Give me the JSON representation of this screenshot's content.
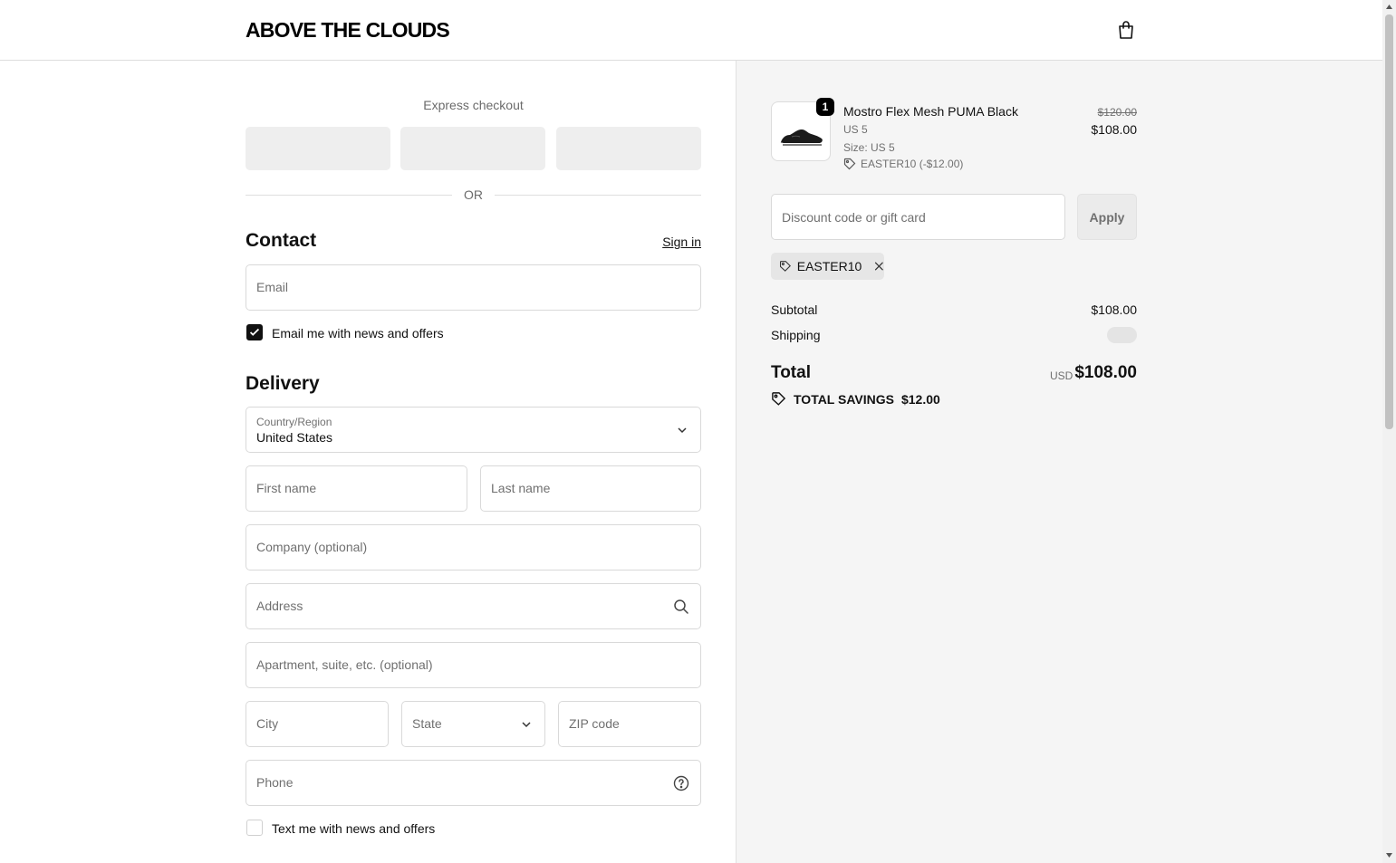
{
  "header": {
    "logo": "ABOVE THE CLOUDS",
    "cart_icon": "shopping-bag-icon"
  },
  "express": {
    "label": "Express checkout",
    "or": "OR"
  },
  "contact": {
    "title": "Contact",
    "signin": "Sign in",
    "email_placeholder": "Email",
    "news_checkbox_label": "Email me with news and offers",
    "news_checked": true
  },
  "delivery": {
    "title": "Delivery",
    "country_label": "Country/Region",
    "country_value": "United States",
    "first_name": "First name",
    "last_name": "Last name",
    "company": "Company (optional)",
    "address": "Address",
    "apartment": "Apartment, suite, etc. (optional)",
    "city": "City",
    "state": "State",
    "zip": "ZIP code",
    "phone": "Phone",
    "text_checkbox_label": "Text me with news and offers",
    "text_checked": false
  },
  "order": {
    "item": {
      "qty": "1",
      "name": "Mostro Flex Mesh PUMA Black",
      "variant": "US 5",
      "size": "Size: US 5",
      "discount": "EASTER10 (-$12.00)",
      "price_old": "$120.00",
      "price_new": "$108.00"
    },
    "discount_placeholder": "Discount code or gift card",
    "apply": "Apply",
    "applied_code": "EASTER10",
    "subtotal_label": "Subtotal",
    "subtotal_value": "$108.00",
    "shipping_label": "Shipping",
    "total_label": "Total",
    "currency": "USD",
    "total_value": "$108.00",
    "savings_label": "TOTAL SAVINGS",
    "savings_value": "$12.00"
  }
}
